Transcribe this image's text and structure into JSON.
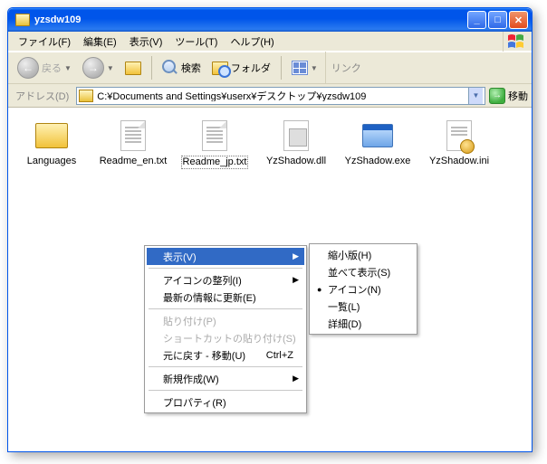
{
  "window": {
    "title": "yzsdw109"
  },
  "menubar": {
    "file": "ファイル(F)",
    "edit": "編集(E)",
    "view": "表示(V)",
    "tools": "ツール(T)",
    "help": "ヘルプ(H)"
  },
  "toolbar": {
    "back": "戻る",
    "search": "検索",
    "folders": "フォルダ",
    "links": "リンク"
  },
  "addressbar": {
    "label": "アドレス(D)",
    "path": "C:¥Documents and Settings¥userx¥デスクトップ¥yzsdw109",
    "go": "移動"
  },
  "items": [
    {
      "name": "Languages",
      "type": "folder"
    },
    {
      "name": "Readme_en.txt",
      "type": "txt"
    },
    {
      "name": "Readme_jp.txt",
      "type": "txt",
      "selected": true
    },
    {
      "name": "YzShadow.dll",
      "type": "dll"
    },
    {
      "name": "YzShadow.exe",
      "type": "exe"
    },
    {
      "name": "YzShadow.ini",
      "type": "ini"
    }
  ],
  "context_menu": {
    "view": "表示(V)",
    "arrange": "アイコンの整列(I)",
    "refresh": "最新の情報に更新(E)",
    "paste": "貼り付け(P)",
    "paste_shortcut": "ショートカットの貼り付け(S)",
    "undo": "元に戻す - 移動(U)",
    "undo_shortcut": "Ctrl+Z",
    "new": "新規作成(W)",
    "properties": "プロパティ(R)"
  },
  "view_submenu": {
    "thumbnails": "縮小版(H)",
    "tiles": "並べて表示(S)",
    "icons": "アイコン(N)",
    "list": "一覧(L)",
    "details": "詳細(D)"
  }
}
